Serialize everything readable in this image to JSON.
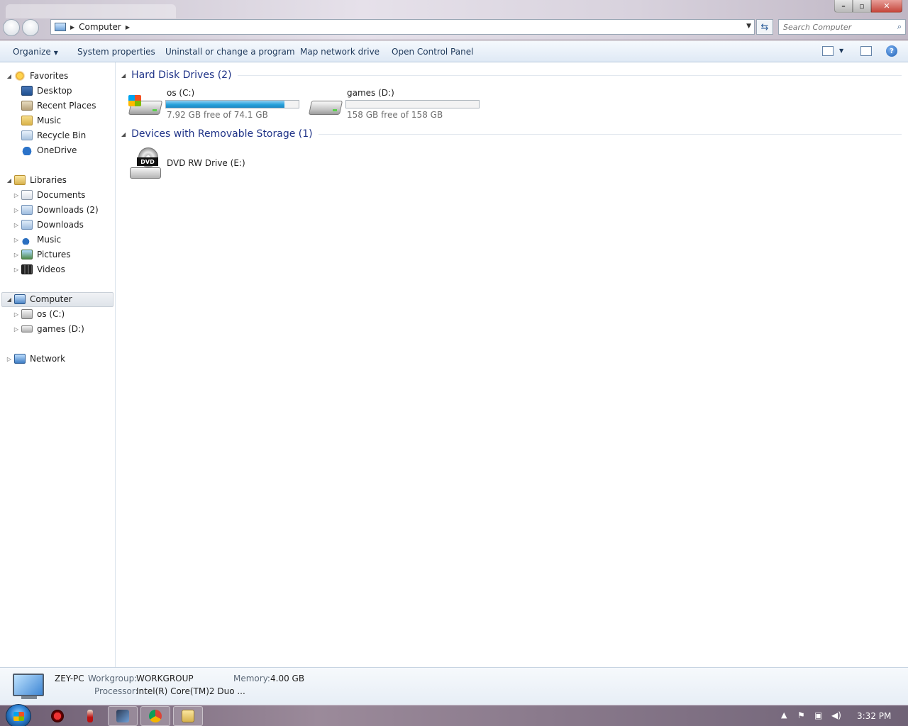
{
  "address": {
    "breadcrumb": "Computer",
    "search_placeholder": "Search Computer"
  },
  "toolbar": {
    "organize": "Organize",
    "system_properties": "System properties",
    "uninstall": "Uninstall or change a program",
    "map_drive": "Map network drive",
    "control_panel": "Open Control Panel"
  },
  "nav": {
    "favorites": "Favorites",
    "desktop": "Desktop",
    "recent": "Recent Places",
    "music_fav": "Music",
    "recycle": "Recycle Bin",
    "onedrive": "OneDrive",
    "libraries": "Libraries",
    "documents": "Documents",
    "downloads2": "Downloads (2)",
    "downloads": "Downloads",
    "music": "Music",
    "pictures": "Pictures",
    "videos": "Videos",
    "computer": "Computer",
    "os_c": "os (C:)",
    "games_d": "games (D:)",
    "network": "Network"
  },
  "content": {
    "hdd_group": "Hard Disk Drives (2)",
    "removable_group": "Devices with Removable Storage (1)",
    "drives": [
      {
        "name": "os (C:)",
        "free_text": "7.92 GB free of 74.1 GB",
        "used_fraction": 0.893
      },
      {
        "name": "games (D:)",
        "free_text": "158 GB free of 158 GB",
        "used_fraction": 0.0
      }
    ],
    "dvd": {
      "name": "DVD RW Drive (E:)",
      "badge": "DVD"
    }
  },
  "details": {
    "pc_name": "ZEY-PC",
    "workgroup_label": "Workgroup:",
    "workgroup": "WORKGROUP",
    "memory_label": "Memory:",
    "memory": "4.00 GB",
    "processor_label": "Processor:",
    "processor": "Intel(R) Core(TM)2 Duo ..."
  },
  "taskbar": {
    "clock": "3:32 PM"
  }
}
